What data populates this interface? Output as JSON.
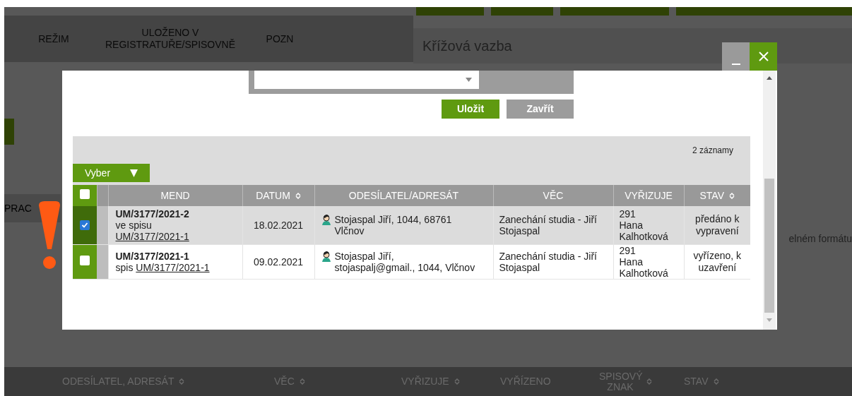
{
  "background": {
    "top_columns": [
      "REŽIM",
      "ULOŽENO V REGISTRATUŘE/SPISOVNĚ",
      "POZN"
    ],
    "panel_title": "Křížová vazba",
    "side_tab": "PRAC",
    "side_text": "elném formátu",
    "bottom_columns": [
      {
        "label": "ODESÍLATEL, ADRESÁT",
        "sortable": true
      },
      {
        "label": "VĚC",
        "sortable": true
      },
      {
        "label": "VYŘIZUJE",
        "sortable": true
      },
      {
        "label": "VYŘÍZENO",
        "sortable": false
      },
      {
        "label": "SPISOVÝ ZNAK",
        "sortable": true
      },
      {
        "label": "STAV",
        "sortable": true
      }
    ]
  },
  "dialog": {
    "save_button": "Uložit",
    "close_button": "Zavřít",
    "record_count": "2 záznamy",
    "select_menu": "Vyber",
    "select_all_checked": false,
    "columns": [
      {
        "label": "MEND",
        "sortable": false
      },
      {
        "label": "DATUM",
        "sortable": true
      },
      {
        "label": "ODESÍLATEL/ADRESÁT",
        "sortable": false
      },
      {
        "label": "VĚC",
        "sortable": false
      },
      {
        "label": "VYŘIZUJE",
        "sortable": false
      },
      {
        "label": "STAV",
        "sortable": true
      }
    ],
    "rows": [
      {
        "selected": true,
        "checked": true,
        "id": "UM/3177/2021-2",
        "relation": "ve spisu",
        "link": "UM/3177/2021-1",
        "date": "18.02.2021",
        "sender": "Stojaspal Jiří, 1044, 68761 Vlčnov",
        "subject": "Zanechání studia - Jiří Stojaspal",
        "handler_code": "291",
        "handler": "Hana Kalhotková",
        "status": "předáno k vypravení"
      },
      {
        "selected": false,
        "checked": false,
        "id": "UM/3177/2021-1",
        "relation": "spis",
        "link": "UM/3177/2021-1",
        "date": "09.02.2021",
        "sender": "Stojaspal Jiří, stojaspalj@gmail., 1044, Vlčnov",
        "subject": "Zanechání studia - Jiří Stojaspal",
        "handler_code": "291",
        "handler": "Hana Kalhotková",
        "status": "vyřízeno, k uzavření"
      }
    ]
  }
}
